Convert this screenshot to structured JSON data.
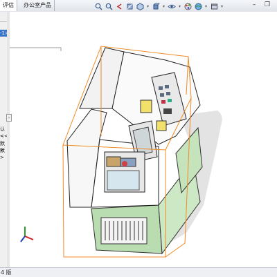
{
  "tabs": [
    {
      "label": "评估"
    },
    {
      "label": "办公室产品"
    }
  ],
  "toolbar_icons": [
    "zoom-fit-icon",
    "zoom-area-icon",
    "previous-view-icon",
    "section-view-icon",
    "view-orientation-icon",
    "display-style-icon",
    "hide-show-items-icon",
    "edit-appearance-icon",
    "apply-scene-icon",
    "view-settings-icon"
  ],
  "window": {
    "minimize": "–",
    "restore": "❐"
  },
  "feature_manager": {
    "selected_item_suffix": "-1>",
    "row_labels": [
      "认<",
      "<<",
      "默<",
      "默>"
    ]
  },
  "status": {
    "text": "4 版"
  },
  "colors": {
    "selection_blue": "#3874c8",
    "bounding_box": "#f08a24",
    "base_green": "#b9ddb0",
    "panel_gray": "#f0f0f0"
  }
}
